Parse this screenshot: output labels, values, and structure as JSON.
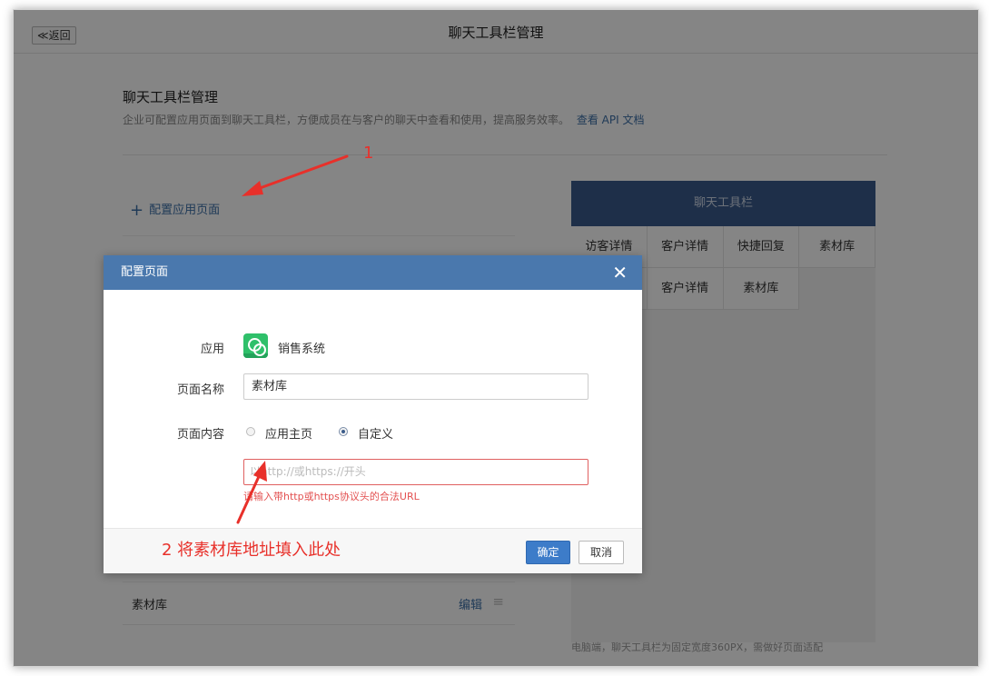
{
  "topbar": {
    "back_label": "≪返回",
    "title": "聊天工具栏管理"
  },
  "section": {
    "title": "聊天工具栏管理",
    "description": "企业可配置应用页面到聊天工具栏，方便成员在与客户的聊天中查看和使用，提高服务效率。",
    "api_link": "查看 API 文档"
  },
  "add_page": {
    "icon": "plus-icon",
    "label": "配置应用页面"
  },
  "list": {
    "items": [
      {
        "name": "素材库",
        "edit_label": "编辑",
        "handle_icon": "drag-handle-icon"
      }
    ]
  },
  "preview": {
    "header": "聊天工具栏",
    "row1": [
      "访客详情",
      "客户详情",
      "快捷回复",
      "素材库"
    ],
    "row2": [
      "",
      "客户详情",
      "素材库",
      ""
    ],
    "note": "电脑端，聊天工具栏为固定宽度360PX，需做好页面适配"
  },
  "modal": {
    "title": "配置页面",
    "close_icon": "close-icon",
    "app_label": "应用",
    "app_icon": "app-link-icon",
    "app_name": "销售系统",
    "page_name_label": "页面名称",
    "page_name_value": "素材库",
    "page_content_label": "页面内容",
    "option_home": "应用主页",
    "option_custom": "自定义",
    "selected_option": "自定义",
    "url_placeholder": "以http://或https://开头",
    "url_value": "",
    "error_text": "请输入带http或https协议头的合法URL",
    "ok_label": "确定",
    "cancel_label": "取消"
  },
  "annotations": {
    "mark_1": "1",
    "mark_2": "2 将素材库地址填入此处",
    "color": "#e8302a"
  },
  "colors": {
    "accent": "#3d7cc9",
    "modal_header": "#4a78ad",
    "preview_header": "#3a5a8c",
    "error": "#e35050",
    "link": "#3d6fa8"
  }
}
